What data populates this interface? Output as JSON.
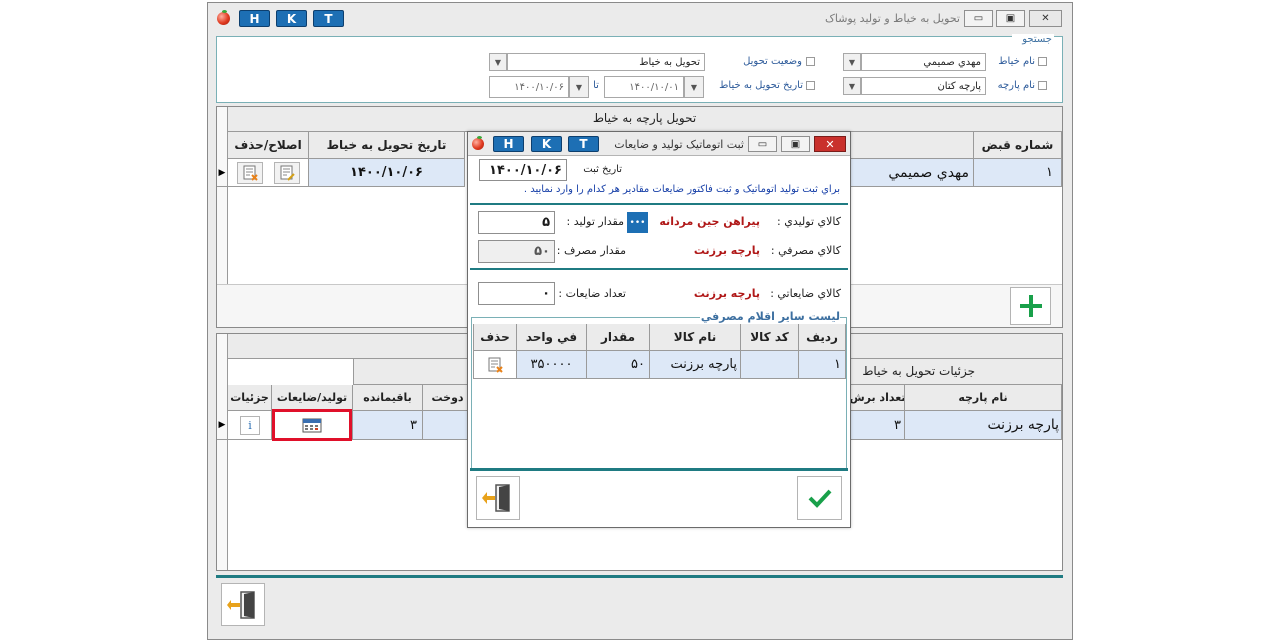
{
  "main_window": {
    "title": "تحويل به خياط و توليد پوشاک",
    "title_buttons": [
      "H",
      "K",
      "T"
    ],
    "controls": {
      "minimize": "▭",
      "restore": "▣",
      "close": "✕"
    }
  },
  "search": {
    "legend": "جستجو",
    "tailor_name_label": "نام خياط",
    "tailor_name_value": "مهدي صميمي",
    "fabric_name_label": "نام پارچه",
    "fabric_name_value": "پارچه کتان",
    "delivery_status_label": "وضعيت تحويل",
    "delivery_status_value": "تحويل به خياط",
    "delivery_date_label": "تاريخ تحويل به خياط",
    "date_from": "۱۴۰۰/۱۰/۰۱",
    "date_to_label": "تا",
    "date_to": "۱۴۰۰/۱۰/۰۶"
  },
  "delivery_grid": {
    "caption": "تحويل پارچه به خياط",
    "columns": {
      "receipt_no": "شماره قبض",
      "tailor": "",
      "date": "تاريخ تحويل به خياط",
      "actions": "اصلاح/حذف"
    },
    "rows": [
      {
        "receipt_no": "۱",
        "tailor": "مهدي صميمي",
        "date": "۱۴۰۰/۱۰/۰۶"
      }
    ]
  },
  "details_grid": {
    "caption": "جزئيات تحويل به خياط",
    "columns": {
      "fabric_name": "نام پارچه",
      "cut_count": "تعداد برش",
      "sewn": "تعداد دوخت",
      "remaining": "باقيمانده",
      "production": "توليد/ضايعات",
      "details": "جزئيات"
    },
    "rows": [
      {
        "fabric_name": "پارچه برزنت",
        "cut_count": "۳",
        "remaining": "۳"
      }
    ]
  },
  "dialog": {
    "title": "ثبت اتوماتيک توليد و ضايعات",
    "title_buttons": [
      "H",
      "K",
      "T"
    ],
    "reg_date_label": "تاريخ ثبت",
    "reg_date_value": "۱۴۰۰/۱۰/۰۶",
    "instructions": "براي ثبت توليد اتوماتيک و ثبت فاکتور ضايعات مقادير هر کدام را وارد نماييد .",
    "produced_item_label": "کالاي توليدي :",
    "produced_item_value": "پيراهن جين مردانه",
    "production_qty_label": "مقدار توليد :",
    "production_qty_value": "۵",
    "more_button": "•••",
    "consumed_item_label": "کالاي مصرفي :",
    "consumed_item_value": "پارچه برزنت",
    "consumption_qty_label": "مقدار مصرف :",
    "consumption_qty_value": "۵۰",
    "waste_item_label": "کالاي ضايعاتي :",
    "waste_item_value": "پارچه برزنت",
    "waste_count_label": "تعداد ضايعات :",
    "waste_count_value": "۰",
    "list_legend": "ليست ساير اقلام مصرفي",
    "list_columns": {
      "row": "رديف",
      "code": "کد کالا",
      "name": "نام کالا",
      "qty": "مقدار",
      "unit_price": "في واحد",
      "delete": "حذف"
    },
    "list_rows": [
      {
        "row": "۱",
        "code": "",
        "name": "پارچه برزنت",
        "qty": "۵۰",
        "unit_price": "۳۵۰۰۰۰"
      }
    ]
  },
  "icons": {
    "add": "plus-icon",
    "exit": "exit-door-icon",
    "confirm": "check-icon"
  },
  "colors": {
    "accent_blue": "#1d6fb4",
    "teal": "#1f7b82",
    "selected_row": "#dde8f7",
    "highlight_red": "#e0102a",
    "value_red": "#b01818",
    "green": "#19a04a"
  }
}
